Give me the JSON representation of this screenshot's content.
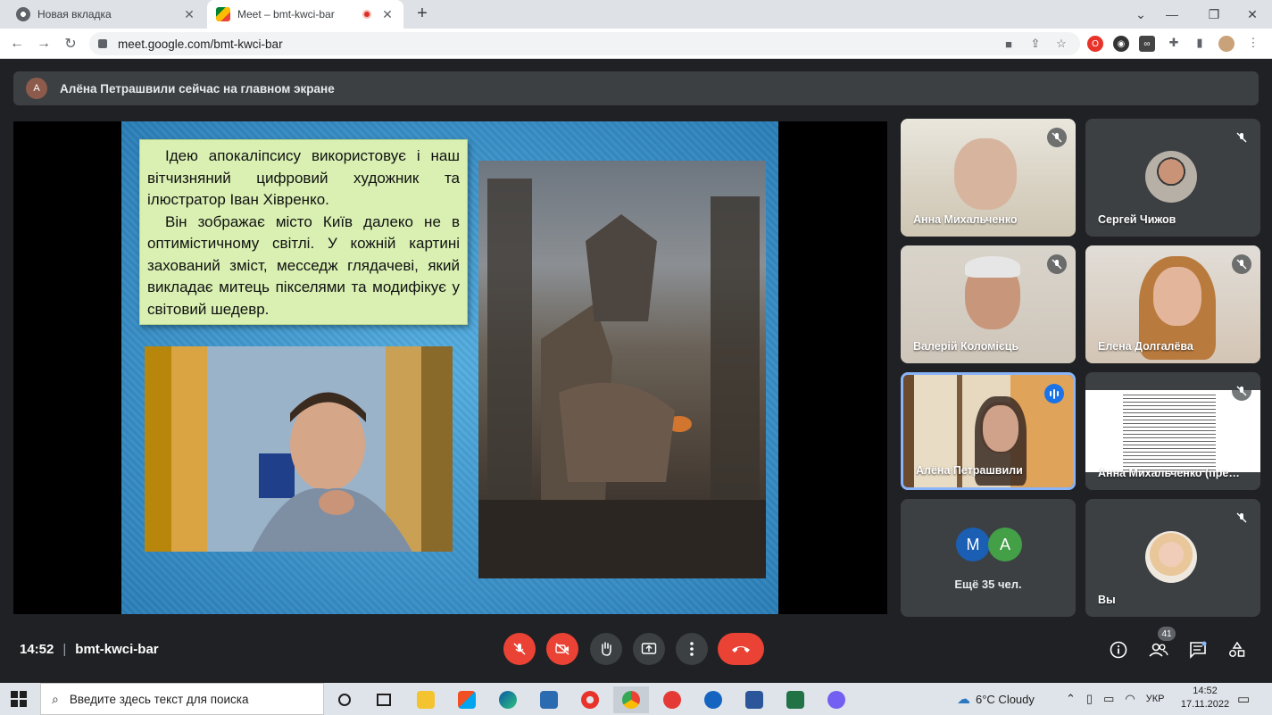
{
  "browser": {
    "tabs": [
      {
        "title": "Новая вкладка",
        "active": false
      },
      {
        "title": "Meet – bmt-kwci-bar",
        "active": true,
        "recording": true
      }
    ],
    "url": "meet.google.com/bmt-kwci-bar"
  },
  "banner": {
    "avatar_letter": "A",
    "text": "Алёна Петрашвили сейчас на главном экране"
  },
  "slide": {
    "paragraph1": "Ідею апокаліпсису використовує і наш вітчизняний цифровий художник та ілюстратор Іван Хівренко.",
    "paragraph2": "Він зображає місто Київ далеко не в оптимістичному світлі. У кожній картині захований зміст, месседж глядачеві, який викладає митець пікселями та модифікує у світовий шедевр."
  },
  "participants": [
    {
      "name": "Анна Михальченко",
      "mic": "muted"
    },
    {
      "name": "Сергей Чижов",
      "mic": "muted"
    },
    {
      "name": "Валерій Коломієць",
      "mic": "muted"
    },
    {
      "name": "Елена Долгалёва",
      "mic": "muted"
    },
    {
      "name": "Алёна Петрашвили",
      "mic": "speaking"
    },
    {
      "name": "Анна Михальченко (пре…",
      "mic": "muted"
    },
    {
      "more_label": "Ещё 35 чел.",
      "avatars": [
        "М",
        "А"
      ]
    },
    {
      "name": "Вы",
      "mic": "muted"
    }
  ],
  "controls": {
    "time": "14:52",
    "meeting_code": "bmt-kwci-bar",
    "people_count": "41"
  },
  "taskbar": {
    "search_placeholder": "Введите здесь текст для поиска",
    "weather": "6°C  Cloudy",
    "language": "УКР",
    "time": "14:52",
    "date": "17.11.2022"
  },
  "colors": {
    "meet_bg": "#202124",
    "tile_bg": "#3c4043",
    "end_call": "#ea4335",
    "active_border": "#8ab4f8"
  }
}
